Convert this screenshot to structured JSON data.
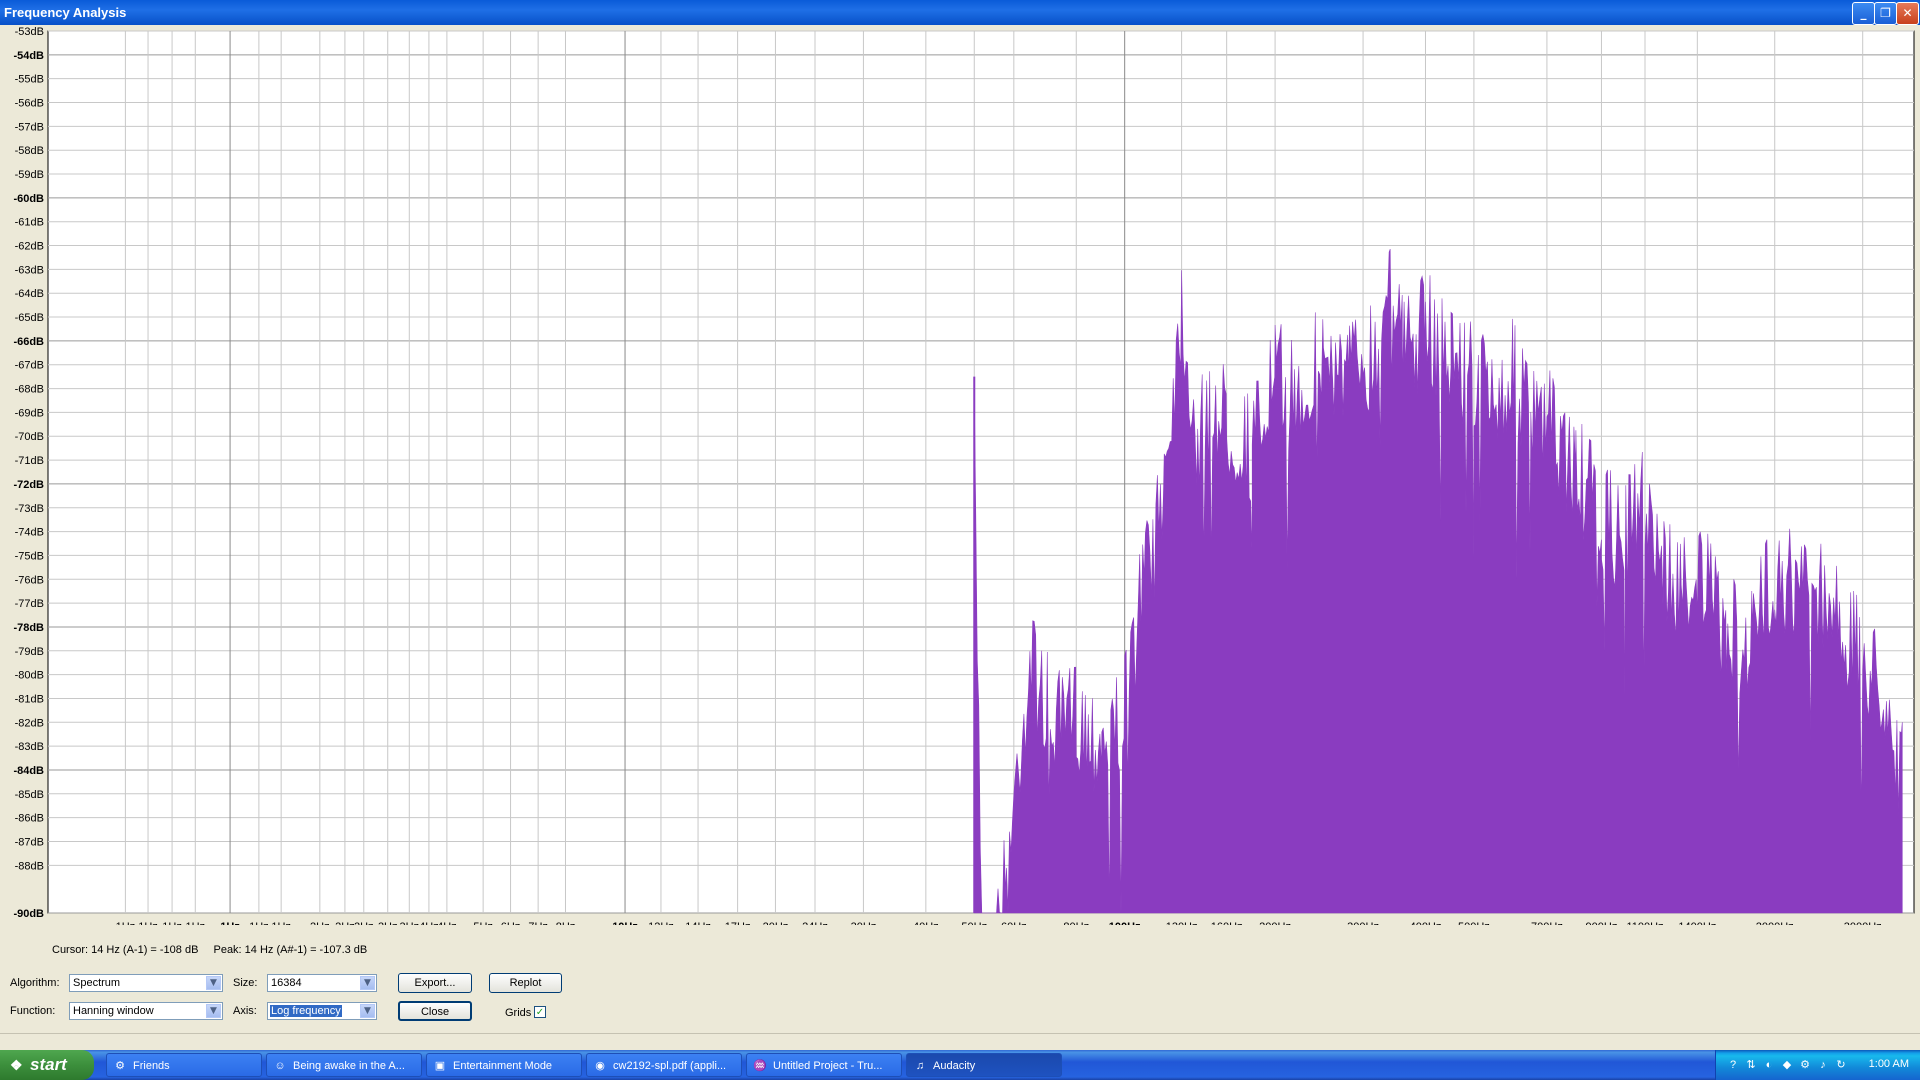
{
  "window": {
    "title": "Frequency Analysis",
    "controls": [
      "minimize",
      "restore",
      "close"
    ]
  },
  "chart_data": {
    "type": "area",
    "title": "",
    "xlabel": "",
    "ylabel": "",
    "x_scale": "log",
    "grid": true,
    "color": "#8a3cc0",
    "ylim": [
      -90,
      -53
    ],
    "y_tick_labels": [
      "-53dB",
      "-54dB",
      "-55dB",
      "-56dB",
      "-57dB",
      "-58dB",
      "-59dB",
      "-60dB",
      "-61dB",
      "-62dB",
      "-63dB",
      "-64dB",
      "-65dB",
      "-66dB",
      "-67dB",
      "-68dB",
      "-69dB",
      "-70dB",
      "-71dB",
      "-72dB",
      "-73dB",
      "-74dB",
      "-75dB",
      "-76dB",
      "-77dB",
      "-78dB",
      "-79dB",
      "-80dB",
      "-81dB",
      "-82dB",
      "-83dB",
      "-84dB",
      "-85dB",
      "-86dB",
      "-87dB",
      "-88dB",
      "-90dB"
    ],
    "x_tick_labels": [
      "1Hz",
      "1Hz",
      "1Hz",
      "1Hz",
      "1Hz",
      "1Hz",
      "1Hz",
      "2Hz",
      "2Hz",
      "2Hz",
      "3Hz",
      "3Hz",
      "4Hz",
      "4Hz",
      "5Hz",
      "6Hz",
      "7Hz",
      "8Hz",
      "10Hz",
      "12Hz",
      "14Hz",
      "17Hz",
      "20Hz",
      "24Hz",
      "30Hz",
      "40Hz",
      "50Hz",
      "60Hz",
      "80Hz",
      "100Hz",
      "130Hz",
      "160Hz",
      "200Hz",
      "300Hz",
      "400Hz",
      "500Hz",
      "700Hz",
      "900Hz",
      "1100Hz",
      "1400Hz",
      "2000Hz",
      "3000Hz"
    ],
    "x": [
      50,
      52,
      55,
      58,
      62,
      65,
      70,
      75,
      80,
      85,
      90,
      95,
      100,
      110,
      120,
      130,
      140,
      150,
      160,
      180,
      200,
      220,
      250,
      280,
      300,
      320,
      340,
      360,
      400,
      450,
      500,
      550,
      600,
      650,
      700,
      800,
      900,
      1000,
      1100,
      1200,
      1300,
      1400,
      1600,
      1800,
      2000,
      2200,
      2500,
      2800,
      3000,
      3300,
      3600
    ],
    "values": [
      -68,
      -90,
      -89,
      -86,
      -80,
      -77,
      -79,
      -80,
      -79,
      -80,
      -80,
      -80,
      -79,
      -73,
      -69,
      -62,
      -68,
      -66,
      -67,
      -68,
      -65,
      -66,
      -64,
      -65,
      -64,
      -64,
      -59,
      -64,
      -63,
      -64,
      -65,
      -66,
      -65,
      -67,
      -67,
      -69,
      -71,
      -72,
      -70,
      -73,
      -74,
      -73,
      -76,
      -76,
      -73,
      -74,
      -74,
      -76,
      -77,
      -78,
      -82
    ]
  },
  "cursor": {
    "cursor_text": "Cursor: 14 Hz (A-1) = -108 dB",
    "peak_text": "Peak: 14 Hz (A#-1) = -107.3 dB"
  },
  "controls": {
    "algorithm_label": "Algorithm:",
    "algorithm_value": "Spectrum",
    "size_label": "Size:",
    "size_value": "16384",
    "function_label": "Function:",
    "function_value": "Hanning window",
    "axis_label": "Axis:",
    "axis_value": "Log frequency",
    "export_label": "Export...",
    "replot_label": "Replot",
    "close_label": "Close",
    "grids_label": "Grids",
    "grids_checked": true
  },
  "taskbar": {
    "start_label": "start",
    "tasks": [
      {
        "label": "Friends",
        "icon": "steam-icon",
        "active": false
      },
      {
        "label": "Being awake in the A...",
        "icon": "chat-icon",
        "active": false
      },
      {
        "label": "Entertainment Mode",
        "icon": "monitor-icon",
        "active": false
      },
      {
        "label": "cw2192-spl.pdf (appli...",
        "icon": "firefox-icon",
        "active": false
      },
      {
        "label": "Untitled Project - Tru...",
        "icon": "audio-icon",
        "active": false
      },
      {
        "label": "Audacity",
        "icon": "audacity-icon",
        "active": true
      }
    ],
    "clock": "1:00 AM"
  }
}
